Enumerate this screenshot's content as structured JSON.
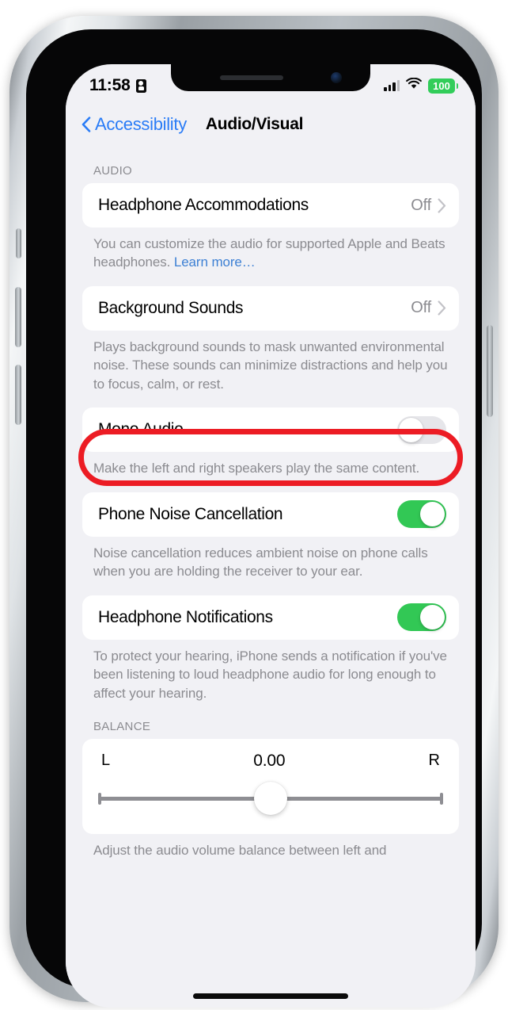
{
  "status_bar": {
    "time": "11:58",
    "lock_icon": "screen-lock-icon",
    "cell_icon": "cellular-signal-icon",
    "wifi_icon": "wifi-icon",
    "battery_level": "100"
  },
  "nav": {
    "back_label": "Accessibility",
    "back_icon": "chevron-left-icon",
    "title": "Audio/Visual"
  },
  "sections": {
    "audio": {
      "header": "AUDIO",
      "headphone_accommodations": {
        "label": "Headphone Accommodations",
        "value": "Off",
        "chevron": "chevron-right-icon",
        "footnote_a": "You can customize the audio for supported Apple and Beats headphones. ",
        "footnote_link": "Learn more…"
      },
      "background_sounds": {
        "label": "Background Sounds",
        "value": "Off",
        "chevron": "chevron-right-icon",
        "footnote": "Plays background sounds to mask unwanted environmental noise. These sounds can minimize distractions and help you to focus, calm, or rest."
      },
      "mono_audio": {
        "label": "Mono Audio",
        "toggle_state": "off",
        "footnote": "Make the left and right speakers play the same content."
      },
      "phone_noise_cancellation": {
        "label": "Phone Noise Cancellation",
        "toggle_state": "on",
        "footnote": "Noise cancellation reduces ambient noise on phone calls when you are holding the receiver to your ear."
      },
      "headphone_notifications": {
        "label": "Headphone Notifications",
        "toggle_state": "on",
        "footnote": "To protect your hearing, iPhone sends a notification if you've been listening to loud headphone audio for long enough to affect your hearing."
      }
    },
    "balance": {
      "header": "BALANCE",
      "left_label": "L",
      "right_label": "R",
      "value": "0.00",
      "slider_position_percent": 50,
      "footnote": "Adjust the audio volume balance between left and"
    }
  },
  "annotation": {
    "shape": "rounded-rectangle-highlight",
    "color": "#ec1c24",
    "targets": "background_sounds_row"
  },
  "colors": {
    "accent_blue": "#2a7cf6",
    "link_blue": "#3d80d4",
    "toggle_on_green": "#32c855",
    "battery_green": "#32cd5a",
    "page_background": "#f1f1f5",
    "card_background": "#ffffff",
    "secondary_text": "#8b8b90",
    "annotation_red": "#ec1c24"
  }
}
